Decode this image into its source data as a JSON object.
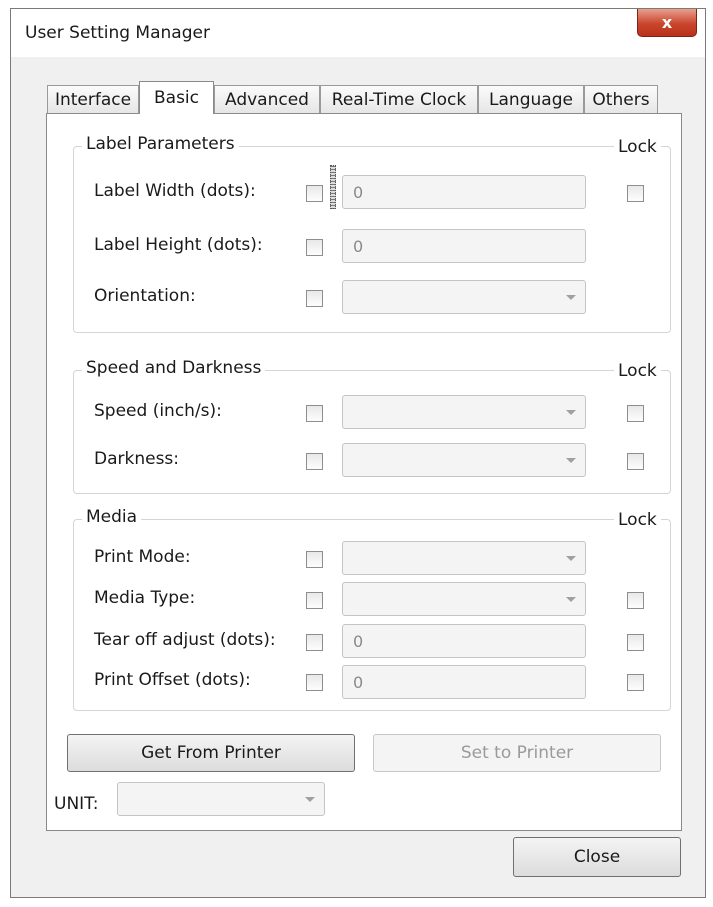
{
  "window": {
    "title": "User Setting Manager",
    "close_glyph": "x"
  },
  "tabs": [
    {
      "label": "Interface"
    },
    {
      "label": "Basic",
      "active": true
    },
    {
      "label": "Advanced"
    },
    {
      "label": "Real-Time Clock"
    },
    {
      "label": "Language"
    },
    {
      "label": "Others"
    }
  ],
  "groups": {
    "label_parameters": {
      "title": "Label Parameters",
      "lock_label": "Lock",
      "label_width": {
        "label": "Label Width (dots):",
        "value": "0"
      },
      "label_height": {
        "label": "Label Height (dots):",
        "value": "0"
      },
      "orientation": {
        "label": "Orientation:",
        "value": ""
      }
    },
    "speed_darkness": {
      "title": "Speed and Darkness",
      "lock_label": "Lock",
      "speed": {
        "label": "Speed (inch/s):",
        "value": ""
      },
      "darkness": {
        "label": "Darkness:",
        "value": ""
      }
    },
    "media": {
      "title": "Media",
      "lock_label": "Lock",
      "print_mode": {
        "label": "Print Mode:",
        "value": ""
      },
      "media_type": {
        "label": "Media Type:",
        "value": ""
      },
      "tear_off": {
        "label": "Tear off adjust (dots):",
        "value": "0"
      },
      "print_offset": {
        "label": "Print Offset (dots):",
        "value": "0"
      }
    }
  },
  "buttons": {
    "get_from_printer": "Get From Printer",
    "set_to_printer": "Set to Printer",
    "close": "Close"
  },
  "unit": {
    "label": "UNIT:",
    "value": ""
  },
  "colors": {
    "window_bg": "#f0f0f0",
    "close_button": "#c9452c",
    "panel_bg": "#ffffff"
  },
  "icons": {
    "dropdown": "chevron-down-icon",
    "close": "close-icon"
  }
}
